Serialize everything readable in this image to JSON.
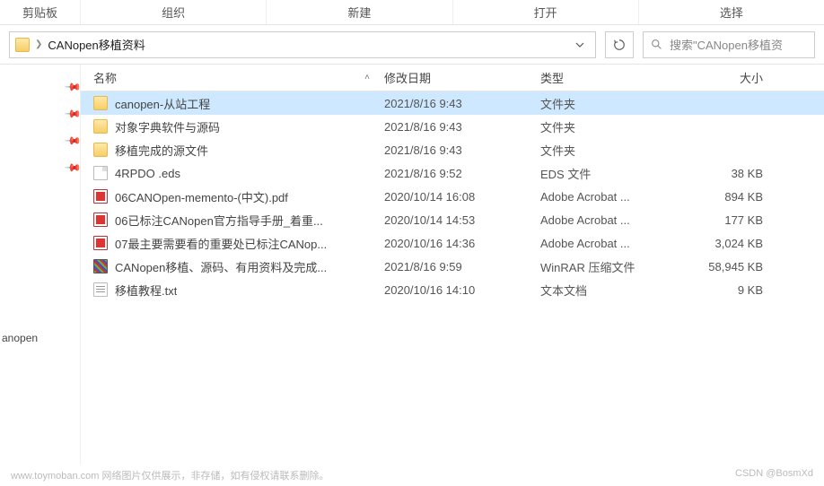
{
  "ribbon": {
    "clipboard": "剪贴板",
    "organize": "组织",
    "new": "新建",
    "open": "打开",
    "select": "选择"
  },
  "breadcrumb": {
    "folder": "CANopen移植资料"
  },
  "search": {
    "placeholder": "搜索\"CANopen移植资"
  },
  "nav_bottom": "anopen",
  "columns": {
    "name": "名称",
    "date": "修改日期",
    "type": "类型",
    "size": "大小"
  },
  "rows": [
    {
      "icon": "folder",
      "name": "canopen-从站工程",
      "date": "2021/8/16 9:43",
      "type": "文件夹",
      "size": "",
      "selected": true
    },
    {
      "icon": "folder",
      "name": "对象字典软件与源码",
      "date": "2021/8/16 9:43",
      "type": "文件夹",
      "size": ""
    },
    {
      "icon": "folder",
      "name": "移植完成的源文件",
      "date": "2021/8/16 9:43",
      "type": "文件夹",
      "size": ""
    },
    {
      "icon": "file",
      "name": "4RPDO .eds",
      "date": "2021/8/16 9:52",
      "type": "EDS 文件",
      "size": "38 KB"
    },
    {
      "icon": "pdf",
      "name": "06CANOpen-memento-(中文).pdf",
      "date": "2020/10/14 16:08",
      "type": "Adobe Acrobat ...",
      "size": "894 KB"
    },
    {
      "icon": "pdf",
      "name": "06已标注CANopen官方指导手册_着重...",
      "date": "2020/10/14 14:53",
      "type": "Adobe Acrobat ...",
      "size": "177 KB"
    },
    {
      "icon": "pdf",
      "name": "07最主要需要看的重要处已标注CANop...",
      "date": "2020/10/16 14:36",
      "type": "Adobe Acrobat ...",
      "size": "3,024 KB"
    },
    {
      "icon": "rar",
      "name": "CANopen移植、源码、有用资料及完成...",
      "date": "2021/8/16 9:59",
      "type": "WinRAR 压缩文件",
      "size": "58,945 KB"
    },
    {
      "icon": "txt",
      "name": "移植教程.txt",
      "date": "2020/10/16 14:10",
      "type": "文本文档",
      "size": "9 KB"
    }
  ],
  "watermarks": {
    "left": "www.toymoban.com  网络图片仅供展示，非存储，如有侵权请联系删除。",
    "right": "CSDN @BosmXd"
  }
}
